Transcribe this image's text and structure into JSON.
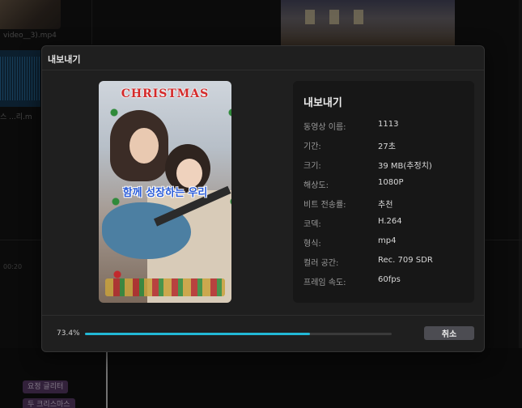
{
  "background": {
    "clip_caption": "video__3).mp4",
    "audio_caption": "스 ...리.m",
    "ruler_time": "00:20",
    "track_chip_1": "요정 글리터",
    "track_chip_2": "두 크리스마스"
  },
  "dialog": {
    "title": "내보내기",
    "info_title": "내보내기",
    "fields": [
      {
        "label": "동영상 이름:",
        "value": "1113"
      },
      {
        "label": "기간:",
        "value": "27초"
      },
      {
        "label": "크기:",
        "value": "39 MB(추정치)"
      },
      {
        "label": "해상도:",
        "value": "1080P"
      },
      {
        "label": "비트 전송률:",
        "value": "추천"
      },
      {
        "label": "코덱:",
        "value": "H.264"
      },
      {
        "label": "형식:",
        "value": "mp4"
      },
      {
        "label": "컬러 공간:",
        "value": "Rec. 709 SDR"
      },
      {
        "label": "프레임 속도:",
        "value": "60fps"
      }
    ],
    "preview": {
      "title_text": "CHRISTMAS",
      "caption_text": "함께 성장하는 우리"
    },
    "progress": {
      "label": "73.4%",
      "fraction": 0.734,
      "color": "#22b8d6"
    },
    "cancel_label": "취소"
  }
}
